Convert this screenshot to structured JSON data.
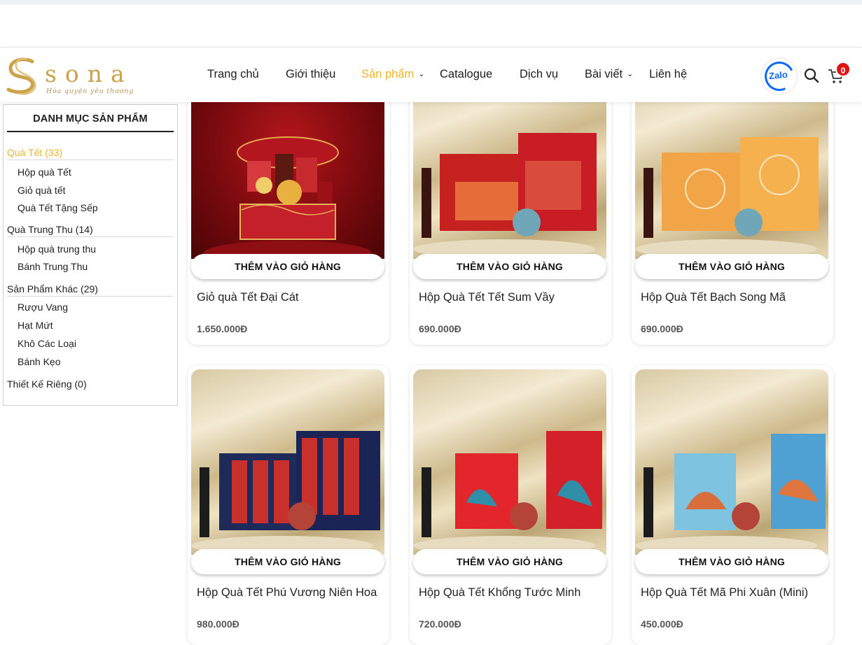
{
  "header": {
    "logo_name": "sona",
    "logo_tagline": "Hòa quyện yêu thương",
    "nav": [
      {
        "label": "Trang chủ",
        "active": false,
        "caret": false
      },
      {
        "label": "Giới thiệu",
        "active": false,
        "caret": false
      },
      {
        "label": "Sản phẩm",
        "active": true,
        "caret": true
      },
      {
        "label": "Catalogue",
        "active": false,
        "caret": false
      },
      {
        "label": "Dịch vụ",
        "active": false,
        "caret": false
      },
      {
        "label": "Bài viết",
        "active": false,
        "caret": true
      },
      {
        "label": "Liên hệ",
        "active": false,
        "caret": false
      }
    ],
    "zalo_label": "Zalo",
    "cart_count": "0",
    "accent_color": "#f0b429",
    "icons": [
      "zalo-icon",
      "search-icon",
      "cart-icon"
    ]
  },
  "sidebar": {
    "title": "DANH MỤC SẢN PHẨM",
    "categories": [
      {
        "label": "Quà Tết (33)",
        "active": true,
        "subs": [
          "Hộp quà Tết",
          "Giỏ quà tết",
          "Quà Tết Tặng Sếp"
        ]
      },
      {
        "label": "Quà Trung Thu (14)",
        "active": false,
        "subs": [
          "Hộp quà trung thu",
          "Bánh Trung Thu"
        ]
      },
      {
        "label": "Sản Phẩm Khác (29)",
        "active": false,
        "subs": [
          "Rượu Vang",
          "Hạt Mứt",
          "Khô Các Loại",
          "Bánh Kẹo"
        ]
      },
      {
        "label": "Thiết Kế Riêng (0)",
        "active": false,
        "subs": []
      }
    ]
  },
  "products": [
    {
      "name": "Giỏ quà Tết Đại Cát",
      "price": "1.650.000Đ",
      "button": "THÊM VÀO GIỎ HÀNG"
    },
    {
      "name": "Hộp Quà Tết Tết Sum Vầy",
      "price": "690.000Đ",
      "button": "THÊM VÀO GIỎ HÀNG"
    },
    {
      "name": "Hộp Quà Tết Bạch Song Mã",
      "price": "690.000Đ",
      "button": "THÊM VÀO GIỎ HÀNG"
    },
    {
      "name": "Hộp Quà Tết Phú Vương Niên Hoa",
      "price": "980.000Đ",
      "button": "THÊM VÀO GIỎ HÀNG"
    },
    {
      "name": "Hộp Quà Tết Khổng Tước Minh",
      "price": "720.000Đ",
      "button": "THÊM VÀO GIỎ HÀNG"
    },
    {
      "name": "Hộp Quà Tết Mã Phi Xuân (Mini)",
      "price": "450.000Đ",
      "button": "THÊM VÀO GIỎ HÀNG"
    }
  ]
}
